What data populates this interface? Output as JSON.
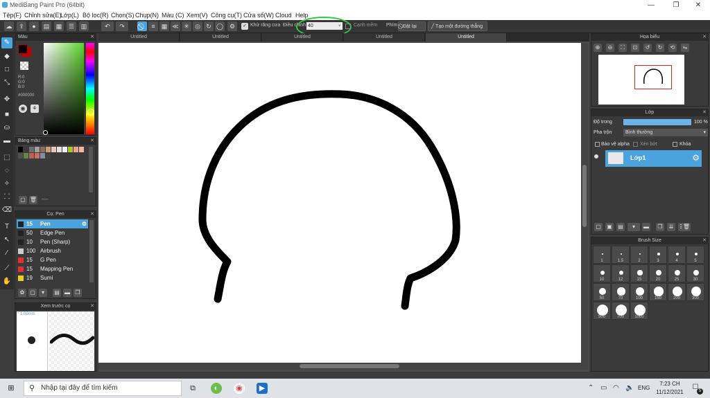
{
  "window": {
    "title": "MediBang Paint Pro (64bit)",
    "min": "—",
    "max": "❐",
    "close": "✕"
  },
  "menu": [
    "Tệp(F)",
    "Chỉnh sửa(E)",
    "Lớp(L)",
    "Bộ lọc(R)",
    "Chọn(S)",
    "Chụp(N)",
    "Màu (C)",
    "Xem(V)",
    "Công cụ(T)",
    "Cửa sổ(W)",
    "Cloud",
    "Help"
  ],
  "toolbar": {
    "antialias_label": "Khử răng cưa",
    "adjust_label": "Điều chỉnh",
    "adjust_value": "40",
    "soft_edge_label": "Cạnh mềm",
    "key_label": "Phím",
    "reset_label": "Đặt lại",
    "straight_line_label": "Tạo một đường thẳng"
  },
  "tabs": [
    "Untitled",
    "Untitled",
    "Untitled",
    "Untitled",
    "Untitled"
  ],
  "color_panel": {
    "title": "Màu",
    "r": "R:0",
    "g": "G:0",
    "b": "B:0",
    "hex": "#000000",
    "primary": "#000000",
    "secondary": "#c00000"
  },
  "palette_panel": {
    "title": "Bảng màu",
    "colors": [
      "#000000",
      "#3a3a3a",
      "#6e6e6e",
      "#a0a0a0",
      "#8a6e5a",
      "#c8a080",
      "#e8c8b8",
      "#e0e0e0",
      "#f0f0f0",
      "#a8c828",
      "#e8a090",
      "#f0b8a0",
      "#505050",
      "#608848",
      "#c06050",
      "#c87060",
      "#8090a0",
      "#404040"
    ],
    "footer": "----"
  },
  "brush_panel": {
    "title": "Cọ: Pen",
    "items": [
      {
        "size": "15",
        "name": "Pen",
        "color": "#222222"
      },
      {
        "size": "50",
        "name": "Edge Pen",
        "color": "#222222"
      },
      {
        "size": "10",
        "name": "Pen (Sharp)",
        "color": "#222222"
      },
      {
        "size": "100",
        "name": "Airbrush",
        "color": "#cccccc"
      },
      {
        "size": "15",
        "name": "G Pen",
        "color": "#e03030"
      },
      {
        "size": "15",
        "name": "Mapping Pen",
        "color": "#e03030"
      },
      {
        "size": "19",
        "name": "Sumi",
        "color": "#e8d020"
      }
    ]
  },
  "preview_panel": {
    "title": "Xem trước cọ",
    "size": "* 1.09mm"
  },
  "navigator_panel": {
    "title": "Họa biểu"
  },
  "layer_panel": {
    "title": "Lớp",
    "opacity_label": "Độ trong",
    "opacity_value": "100 %",
    "opacity_fraction": 1.0,
    "blend_label": "Pha trộn",
    "blend_value": "Bình thường",
    "protect_alpha": "Bảo vệ alpha",
    "clip": "Xén bớt",
    "lock": "Khóa",
    "layer_name": "Lớp1"
  },
  "brushsize_panel": {
    "title": "Brush Size",
    "sizes": [
      "1",
      "1.5",
      "2",
      "3",
      "4",
      "5",
      "10",
      "12",
      "15",
      "20",
      "25",
      "30",
      "50",
      "70",
      "100",
      "150",
      "200",
      "300",
      "500",
      "700",
      "1000"
    ]
  },
  "taskbar": {
    "search_placeholder": "Nhập tại đây để tìm kiếm",
    "lang": "ENG",
    "time": "7:23 CH",
    "date": "11/12/2021",
    "notif": "5"
  }
}
